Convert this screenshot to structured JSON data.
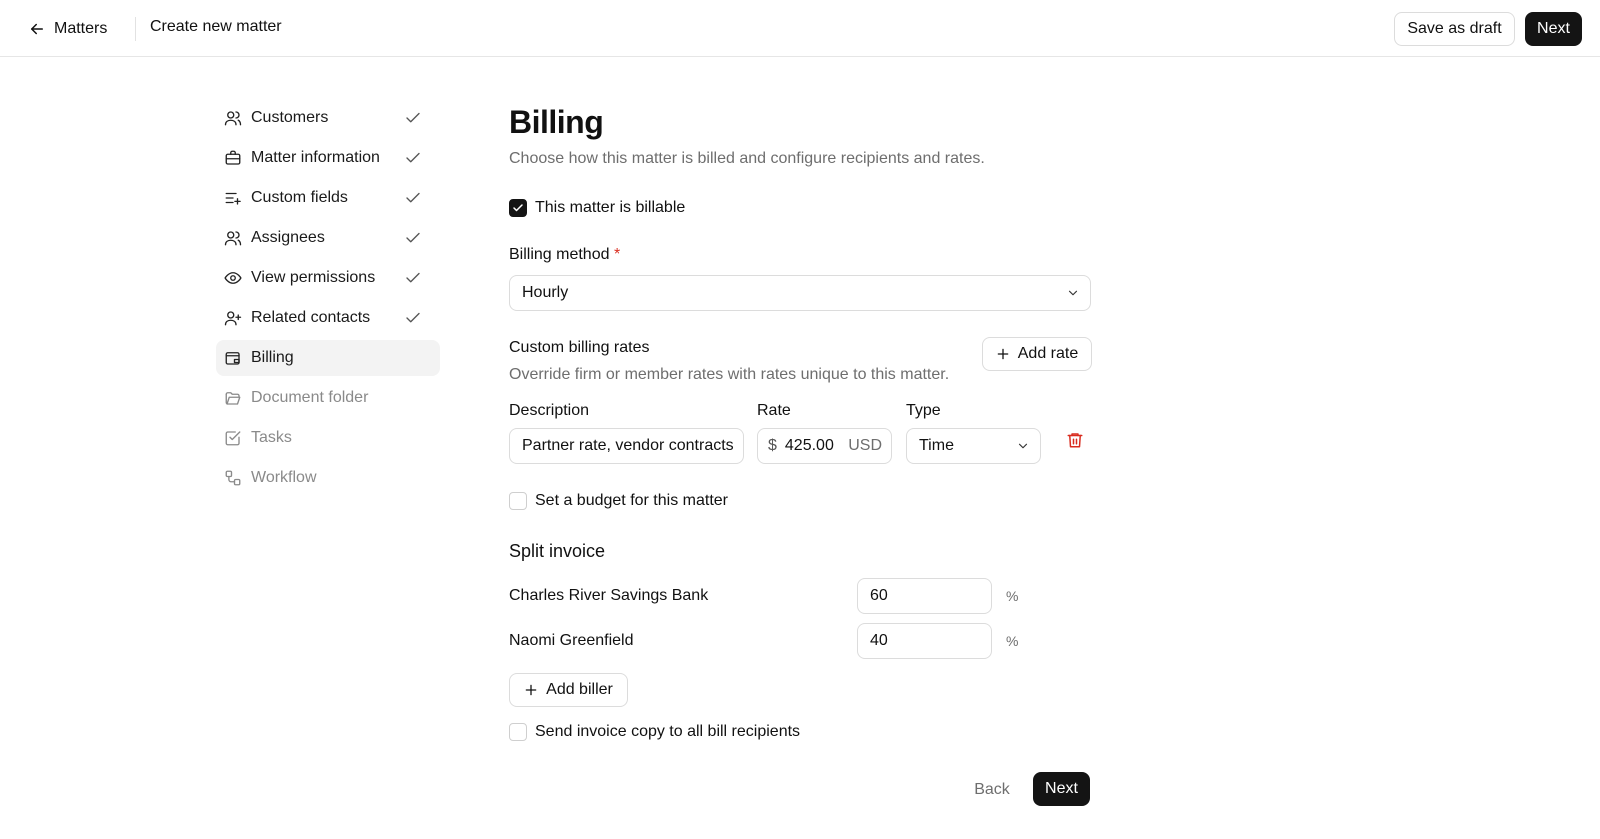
{
  "header": {
    "back_label": "Matters",
    "title": "Create new matter",
    "save_draft_label": "Save as draft",
    "next_label": "Next"
  },
  "sidebar": {
    "steps": [
      {
        "label": "Customers",
        "icon": "users-icon",
        "status": "complete"
      },
      {
        "label": "Matter information",
        "icon": "briefcase-icon",
        "status": "complete"
      },
      {
        "label": "Custom fields",
        "icon": "list-plus-icon",
        "status": "complete"
      },
      {
        "label": "Assignees",
        "icon": "users-icon",
        "status": "complete"
      },
      {
        "label": "View permissions",
        "icon": "eye-icon",
        "status": "complete"
      },
      {
        "label": "Related contacts",
        "icon": "user-plus-icon",
        "status": "complete"
      },
      {
        "label": "Billing",
        "icon": "wallet-icon",
        "status": "active"
      },
      {
        "label": "Document folder",
        "icon": "folder-open-icon",
        "status": "pending"
      },
      {
        "label": "Tasks",
        "icon": "checkbox-icon",
        "status": "pending"
      },
      {
        "label": "Workflow",
        "icon": "workflow-icon",
        "status": "pending"
      }
    ]
  },
  "billing": {
    "title": "Billing",
    "subtitle": "Choose how this matter is billed and configure recipients and rates.",
    "billable_label": "This matter is billable",
    "billable_checked": true,
    "method_label": "Billing method",
    "method_required": "*",
    "method_value": "Hourly",
    "custom_rates": {
      "title": "Custom billing rates",
      "subtitle": "Override firm or member rates with rates unique to this matter.",
      "add_rate_label": "Add rate",
      "col_description": "Description",
      "col_rate": "Rate",
      "col_type": "Type",
      "rows": [
        {
          "description": "Partner rate, vendor contracts",
          "currency_symbol": "$",
          "rate": "425.00",
          "currency": "USD",
          "type": "Time"
        }
      ]
    },
    "budget_label": "Set a budget for this matter",
    "budget_checked": false,
    "split": {
      "title": "Split invoice",
      "rows": [
        {
          "name": "Charles River Savings Bank",
          "percent": "60",
          "unit": "%"
        },
        {
          "name": "Naomi Greenfield",
          "percent": "40",
          "unit": "%"
        }
      ],
      "add_biller_label": "Add biller"
    },
    "send_copy_label": "Send invoice copy to all bill recipients",
    "send_copy_checked": false
  },
  "footer": {
    "back_label": "Back",
    "next_label": "Next"
  },
  "colors": {
    "primary": "#141414",
    "danger": "#d92d20",
    "muted": "#6e6e6e",
    "border": "#dcdcdc",
    "active_bg": "#f3f3f3"
  }
}
